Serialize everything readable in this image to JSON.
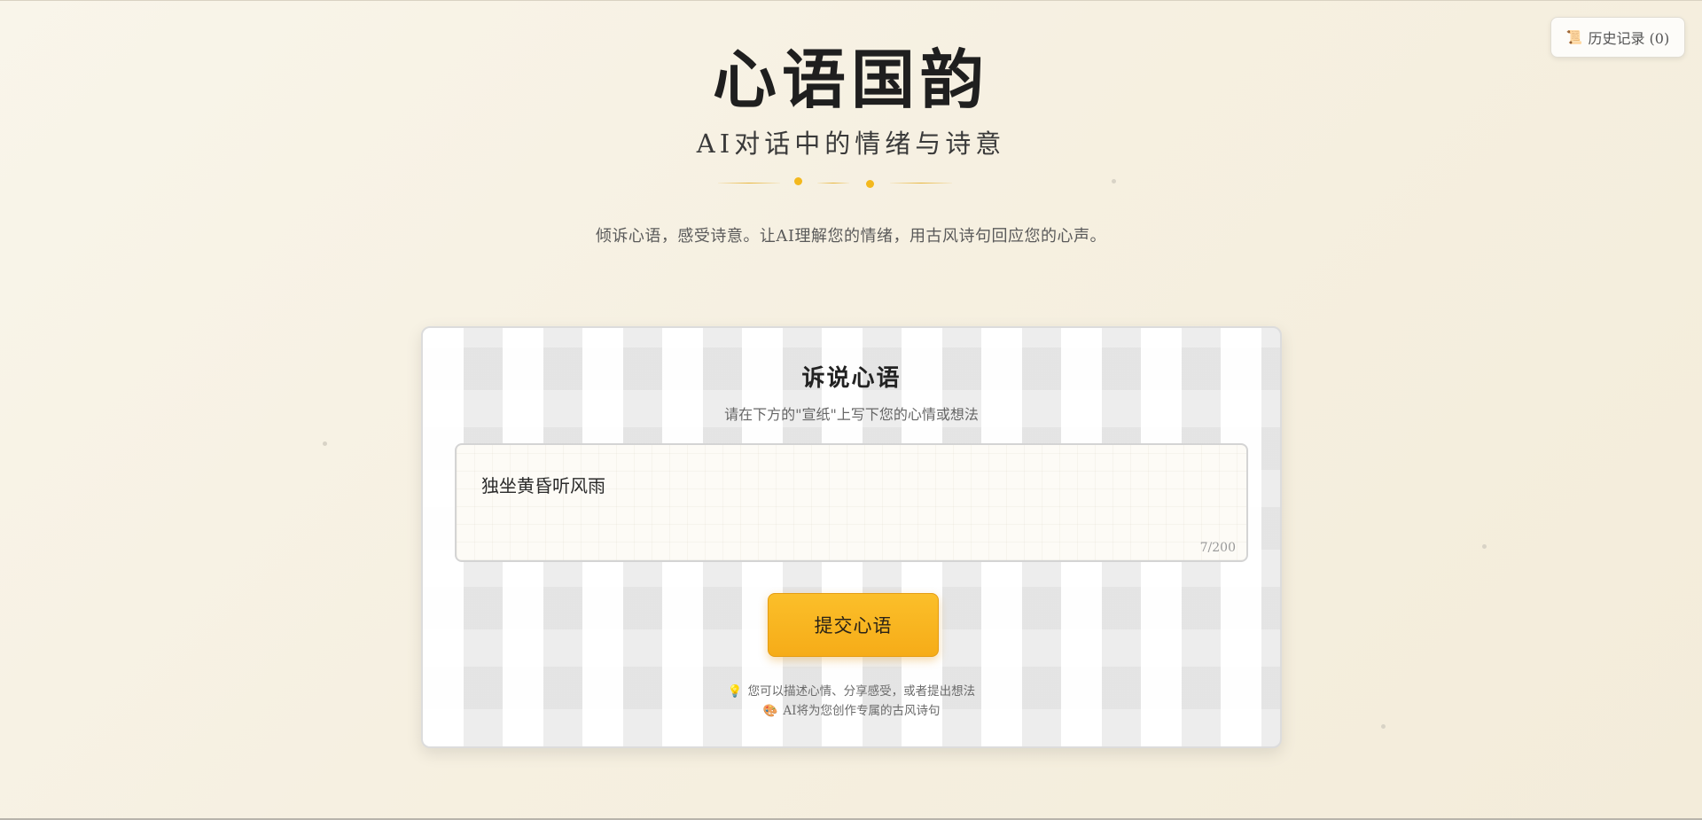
{
  "history": {
    "icon": "scroll-icon",
    "label": "历史记录 (0)"
  },
  "header": {
    "title": "心语国韵",
    "subtitle": "AI对话中的情绪与诗意",
    "intro": "倾诉心语，感受诗意。让AI理解您的情绪，用古风诗句回应您的心声。"
  },
  "card": {
    "title": "诉说心语",
    "subtitle": "请在下方的\"宣纸\"上写下您的心情或想法",
    "input": {
      "value": "独坐黄昏听风雨",
      "counter": "7/200"
    },
    "submit_label": "提交心语",
    "tips": [
      {
        "icon": "lightbulb-icon",
        "text": "您可以描述心情、分享感受，或者提出想法"
      },
      {
        "icon": "palette-icon",
        "text": "AI将为您创作专属的古风诗句"
      }
    ]
  },
  "colors": {
    "accent": "#f6ac18",
    "divider_dot": "#f3b81d",
    "background": "#f7f1e3"
  }
}
